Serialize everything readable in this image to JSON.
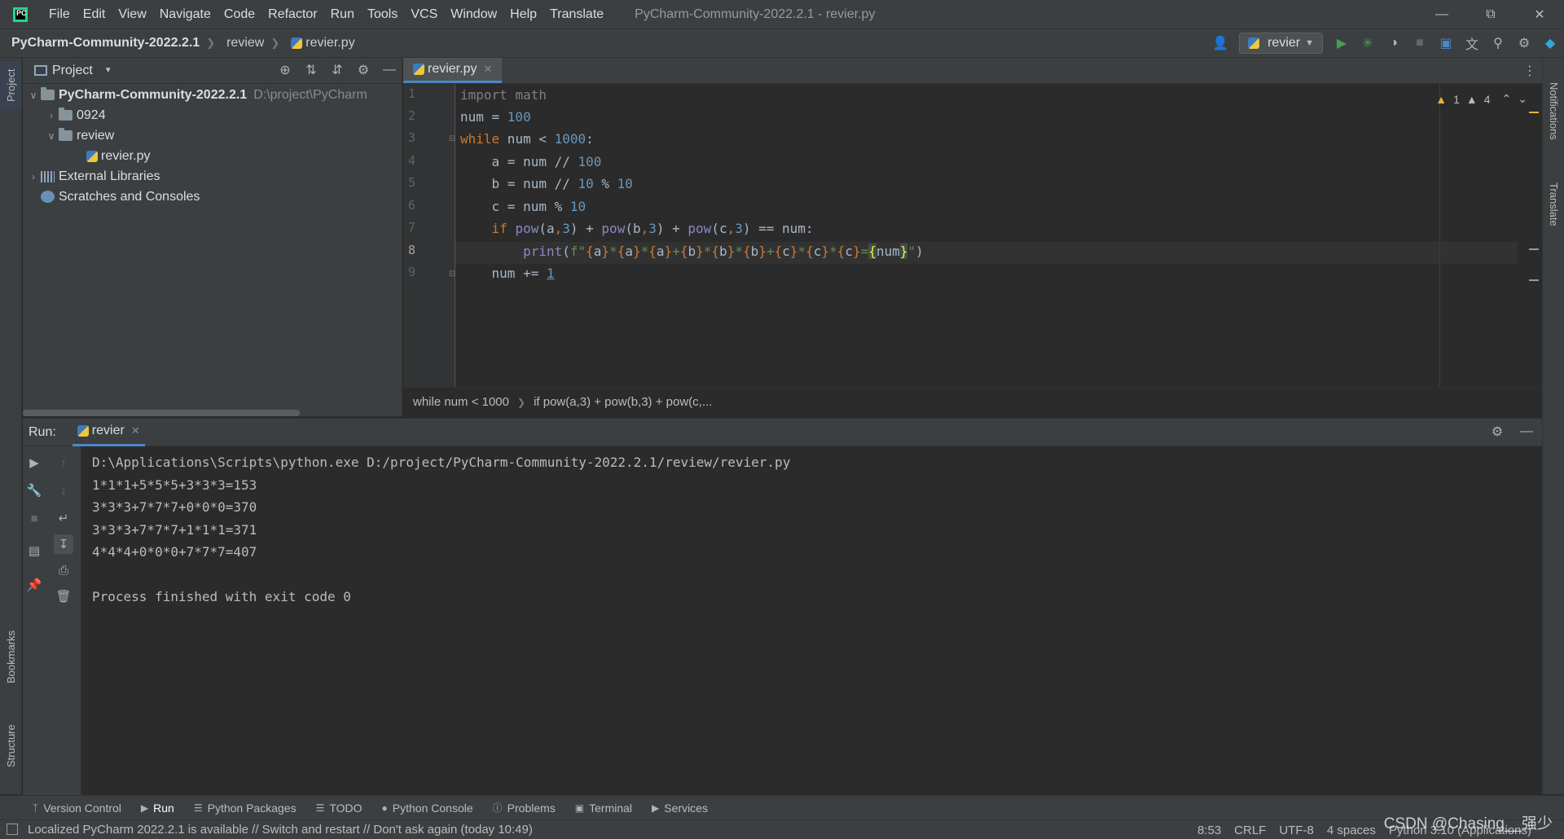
{
  "titlebar": {
    "menu": [
      "File",
      "Edit",
      "View",
      "Navigate",
      "Code",
      "Refactor",
      "Run",
      "Tools",
      "VCS",
      "Window",
      "Help",
      "Translate"
    ],
    "window_title": "PyCharm-Community-2022.2.1 - revier.py"
  },
  "navbar": {
    "crumbs": [
      "PyCharm-Community-2022.2.1",
      "review",
      "revier.py"
    ],
    "run_config": "revier"
  },
  "project": {
    "title": "Project",
    "tree": [
      {
        "label": "PyCharm-Community-2022.2.1",
        "path": "D:\\project\\PyCharm"
      },
      {
        "label": "0924"
      },
      {
        "label": "review"
      },
      {
        "label": "revier.py"
      },
      {
        "label": "External Libraries"
      },
      {
        "label": "Scratches and Consoles"
      }
    ]
  },
  "editor": {
    "tab": "revier.py",
    "line_numbers": [
      "1",
      "2",
      "3",
      "4",
      "5",
      "6",
      "7",
      "8",
      "9"
    ],
    "inspection": {
      "warnings": "1",
      "weak_warnings": "4"
    },
    "breadcrumb": [
      "while num < 1000",
      "if pow(a,3) + pow(b,3) + pow(c,..."
    ]
  },
  "run": {
    "label": "Run:",
    "tab": "revier",
    "console": [
      "D:\\Applications\\Scripts\\python.exe D:/project/PyCharm-Community-2022.2.1/review/revier.py",
      "1*1*1+5*5*5+3*3*3=153",
      "3*3*3+7*7*7+0*0*0=370",
      "3*3*3+7*7*7+1*1*1=371",
      "4*4*4+0*0*0+7*7*7=407",
      "",
      "Process finished with exit code 0"
    ]
  },
  "left_strip": {
    "project": "Project",
    "bookmarks": "Bookmarks",
    "structure": "Structure"
  },
  "right_strip": {
    "notifications": "Notifications",
    "translate": "Translate"
  },
  "bottom_tools": [
    "Version Control",
    "Run",
    "Python Packages",
    "TODO",
    "Python Console",
    "Problems",
    "Terminal",
    "Services"
  ],
  "status": {
    "message": "Localized PyCharm 2022.2.1 is available // Switch and restart // Don't ask again (today 10:49)",
    "position": "8:53",
    "line_sep": "CRLF",
    "encoding": "UTF-8",
    "indent": "4 spaces",
    "interpreter": "Python 3.10 (Applications)"
  },
  "watermark": "CSDN @Chasing__强少"
}
